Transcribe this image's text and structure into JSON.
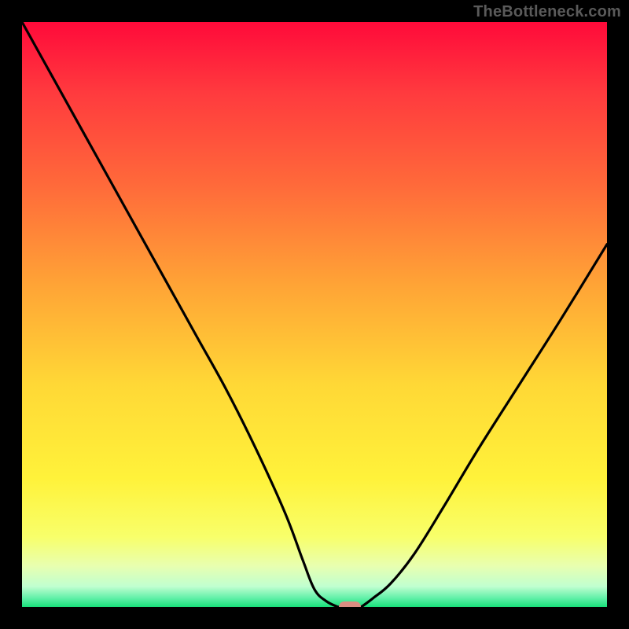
{
  "watermark": "TheBottleneck.com",
  "chart_data": {
    "type": "line",
    "title": "",
    "xlabel": "",
    "ylabel": "",
    "xlim": [
      0,
      100
    ],
    "ylim": [
      0,
      100
    ],
    "grid": false,
    "legend": false,
    "series": [
      {
        "name": "bottleneck-curve-left",
        "x": [
          0,
          5,
          10,
          15,
          20,
          25,
          30,
          35,
          40,
          45,
          48,
          50,
          52,
          54
        ],
        "y": [
          100,
          91,
          82,
          73,
          64,
          55,
          46,
          37,
          27,
          16,
          8,
          3,
          1,
          0
        ]
      },
      {
        "name": "bottleneck-curve-right",
        "x": [
          58,
          60,
          63,
          67,
          72,
          78,
          85,
          92,
          100
        ],
        "y": [
          0,
          1.5,
          4,
          9,
          17,
          27,
          38,
          49,
          62
        ]
      }
    ],
    "marker": {
      "x": 56,
      "y": 0,
      "color": "#db8d82"
    },
    "gradient_stops": [
      {
        "offset": 0.0,
        "color": "#ff0a3a"
      },
      {
        "offset": 0.12,
        "color": "#ff3a3e"
      },
      {
        "offset": 0.28,
        "color": "#ff6a3a"
      },
      {
        "offset": 0.45,
        "color": "#ffa436"
      },
      {
        "offset": 0.62,
        "color": "#ffd836"
      },
      {
        "offset": 0.78,
        "color": "#fff23a"
      },
      {
        "offset": 0.88,
        "color": "#f8ff6a"
      },
      {
        "offset": 0.93,
        "color": "#e8ffb0"
      },
      {
        "offset": 0.965,
        "color": "#c0ffd0"
      },
      {
        "offset": 0.985,
        "color": "#60f0a8"
      },
      {
        "offset": 1.0,
        "color": "#18e07a"
      }
    ]
  }
}
